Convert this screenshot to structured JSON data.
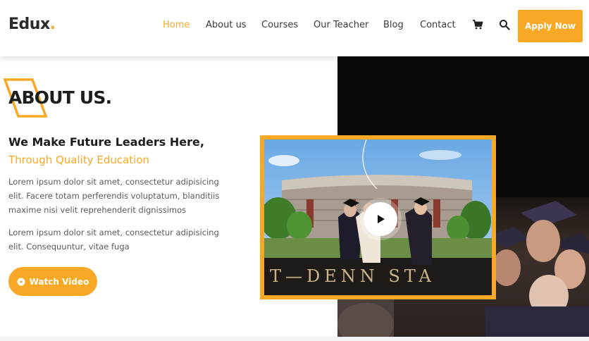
{
  "brand": {
    "name": "Edux",
    "dot": ".",
    "accent": "#f9a826"
  },
  "nav": {
    "items": [
      {
        "label": "Home",
        "active": true
      },
      {
        "label": "About us"
      },
      {
        "label": "Courses"
      },
      {
        "label": "Our Teacher"
      },
      {
        "label": "Blog"
      },
      {
        "label": "Contact"
      }
    ],
    "cart_icon": "cart-icon",
    "search_icon": "search-icon",
    "apply_label": "Apply Now"
  },
  "about": {
    "title": "ABOUT US.",
    "subtitle_1": "We Make Future Leaders Here,",
    "subtitle_2": "Through Quality Education",
    "paragraph_1": "Lorem ipsum dolor sit amet, consectetur adipisicing elit. Facere totam perferendis voluptatum, blanditiis maxime nisi velit reprehenderit dignissimos",
    "paragraph_2": "Lorem ipsum dolor sit amet, consectetur adipisicing elit. Consequuntur, vitae fuga",
    "watch_label": "Watch Video"
  },
  "video": {
    "sign_text": "T—DENN STA",
    "play_icon": "play-icon"
  }
}
